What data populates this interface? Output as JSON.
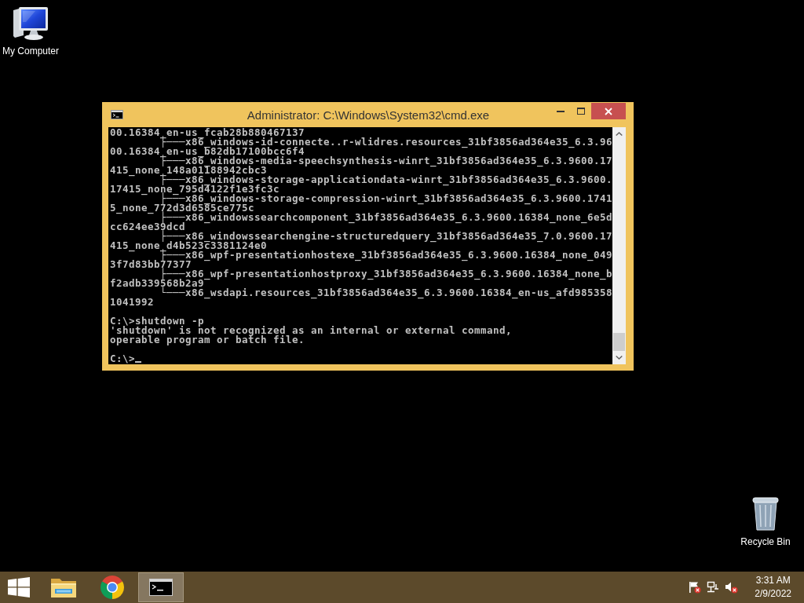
{
  "desktop_icons": [
    {
      "label": "My Computer",
      "kind": "computer"
    },
    {
      "label": "Recycle Bin",
      "kind": "trash"
    }
  ],
  "window": {
    "title": "Administrator: C:\\Windows\\System32\\cmd.exe",
    "console": {
      "cursor": true,
      "blocks": [
        [
          {
            "kind": "text",
            "text": "00.16384_en-us_fcab28b880467137"
          },
          {
            "kind": "branch",
            "text": "├───x86_windows-id-connecte..r-wlidres.resources_31bf3856ad364e35_6.3.96"
          },
          {
            "kind": "text",
            "text": "00.16384_en-us_b82db17100bcc6f4"
          },
          {
            "kind": "branch",
            "text": "├───x86_windows-media-speechsynthesis-winrt_31bf3856ad364e35_6.3.9600.17"
          },
          {
            "kind": "text",
            "text": "415_none_148a01188942cbc3"
          },
          {
            "kind": "branch",
            "text": "├───x86_windows-storage-applicationdata-winrt_31bf3856ad364e35_6.3.9600."
          },
          {
            "kind": "text",
            "text": "17415_none_795d4122f1e3fc3c"
          },
          {
            "kind": "branch",
            "text": "├───x86_windows-storage-compression-winrt_31bf3856ad364e35_6.3.9600.1741"
          },
          {
            "kind": "text",
            "text": "5_none_772d3d6585ce775c"
          },
          {
            "kind": "branch",
            "text": "├───x86_windowssearchcomponent_31bf3856ad364e35_6.3.9600.16384_none_6e5d"
          },
          {
            "kind": "text",
            "text": "cc624ee39dcd"
          },
          {
            "kind": "branch",
            "text": "├───x86_windowssearchengine-structuredquery_31bf3856ad364e35_7.0.9600.17"
          },
          {
            "kind": "text",
            "text": "415_none_d4b523c3381124e0"
          },
          {
            "kind": "branch",
            "text": "├───x86_wpf-presentationhostexe_31bf3856ad364e35_6.3.9600.16384_none_049"
          },
          {
            "kind": "text",
            "text": "3f7d83bb77377"
          },
          {
            "kind": "branch",
            "text": "├───x86_wpf-presentationhostproxy_31bf3856ad364e35_6.3.9600.16384_none_b"
          },
          {
            "kind": "text",
            "text": "f2adb339568b2a9"
          },
          {
            "kind": "branch",
            "text": "└───x86_wsdapi.resources_31bf3856ad364e35_6.3.9600.16384_en-us_afd985358"
          },
          {
            "kind": "text",
            "text": "1041992"
          }
        ],
        [
          {
            "kind": "text",
            "text": "C:\\>shutdown -p"
          },
          {
            "kind": "text",
            "text": "'shutdown' is not recognized as an internal or external command,"
          },
          {
            "kind": "text",
            "text": "operable program or batch file."
          }
        ],
        [
          {
            "kind": "text",
            "text": "C:\\>"
          }
        ]
      ]
    }
  },
  "taskbar": {
    "apps": [
      {
        "kind": "folder",
        "selected": false
      },
      {
        "kind": "browser",
        "selected": false
      },
      {
        "kind": "console",
        "selected": true
      }
    ],
    "clock": {
      "time": "3:31 AM",
      "date": "2/9/2022"
    }
  }
}
